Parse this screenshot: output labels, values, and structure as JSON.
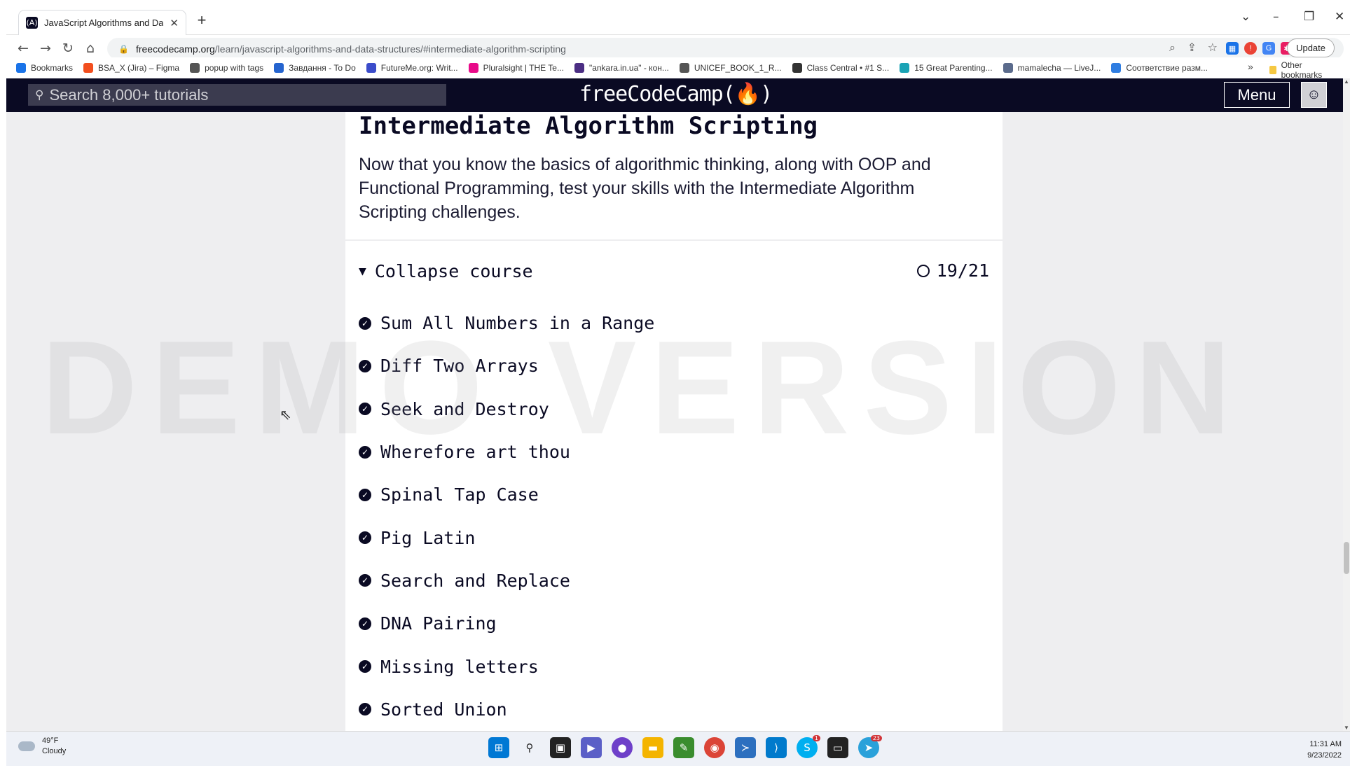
{
  "browser": {
    "tab_title": "JavaScript Algorithms and Data S",
    "new_tab": "+",
    "address": {
      "host": "freecodecamp.org",
      "path": "/learn/javascript-algorithms-and-data-structures/#intermediate-algorithm-scripting"
    },
    "update_label": "Update",
    "bookmarks": [
      {
        "label": "Bookmarks",
        "color": "#1a73e8"
      },
      {
        "label": "BSA_X (Jira) – Figma",
        "color": "#f24e1e"
      },
      {
        "label": "popup with tags",
        "color": "#555555"
      },
      {
        "label": "Завдання - To Do",
        "color": "#2564cf"
      },
      {
        "label": "FutureMe.org: Writ...",
        "color": "#3b4cca"
      },
      {
        "label": "Pluralsight | THE Te...",
        "color": "#e80a89"
      },
      {
        "label": "\"ankara.in.ua\" - кон...",
        "color": "#4b2e83"
      },
      {
        "label": "UNICEF_BOOK_1_R...",
        "color": "#555555"
      },
      {
        "label": "Class Central • #1 S...",
        "color": "#333333"
      },
      {
        "label": "15 Great Parenting...",
        "color": "#1aa3b5"
      },
      {
        "label": "mamalecha — LiveJ...",
        "color": "#5b6b8c"
      },
      {
        "label": "Соответствие разм...",
        "color": "#2f7de1"
      }
    ],
    "bookmarks_more": "»",
    "other_bookmarks": "Other bookmarks"
  },
  "fcc": {
    "search_placeholder": "Search 8,000+ tutorials",
    "logo": "freeCodeCamp(🔥)",
    "menu_label": "Menu"
  },
  "section": {
    "title": "Intermediate Algorithm Scripting",
    "description": "Now that you know the basics of algorithmic thinking, along with OOP and Functional Programming, test your skills with the Intermediate Algorithm Scripting challenges.",
    "collapse_label": "Collapse course",
    "progress": "19/21",
    "challenges": [
      "Sum All Numbers in a Range",
      "Diff Two Arrays",
      "Seek and Destroy",
      "Wherefore art thou",
      "Spinal Tap Case",
      "Pig Latin",
      "Search and Replace",
      "DNA Pairing",
      "Missing letters",
      "Sorted Union"
    ]
  },
  "watermark": "DEMO VERSION",
  "taskbar": {
    "weather_temp": "49°F",
    "weather_text": "Cloudy",
    "time": "11:31 AM",
    "date": "9/23/2022",
    "badges": {
      "skype": "1",
      "telegram": "23"
    }
  }
}
